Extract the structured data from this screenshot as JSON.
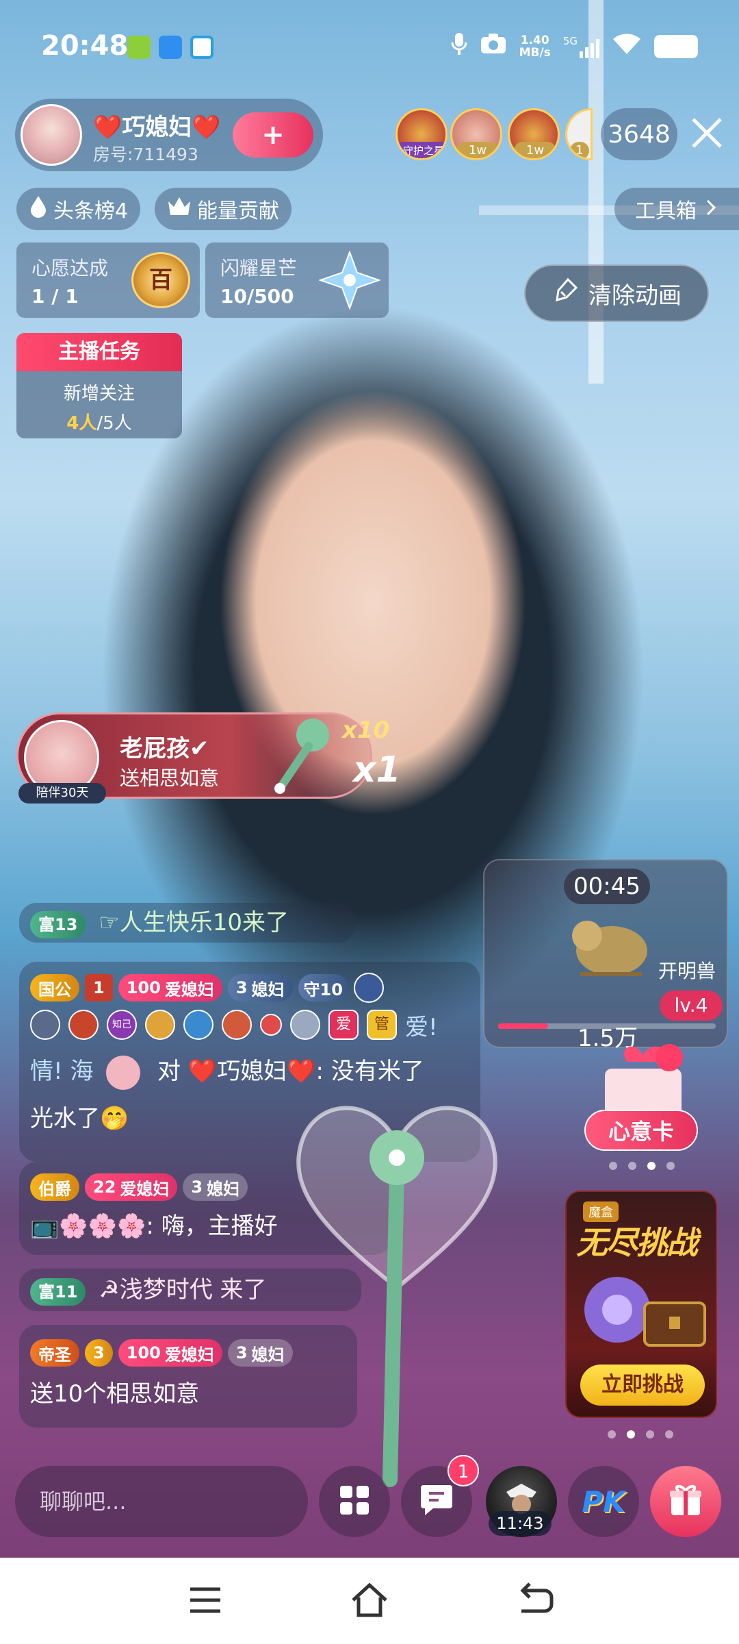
{
  "status_bar": {
    "time": "20:48",
    "net_speed_value": "1.40",
    "net_speed_unit": "MB/s",
    "network": "5G"
  },
  "host": {
    "name": "❤️巧媳妇❤️",
    "room": "房号:711493",
    "follow_label": "+"
  },
  "viewers": {
    "badge1": "守护之星",
    "badge2": "1w",
    "badge3": "1w",
    "badge4": "1",
    "count": "3648"
  },
  "chips": {
    "headline": "头条榜4",
    "energy": "能量贡献",
    "toolbox": "工具箱"
  },
  "wish": {
    "title": "心愿达成",
    "value": "1 / 1",
    "medal": "百"
  },
  "star": {
    "title": "闪耀星芒",
    "value": "10/500"
  },
  "clear_anim": "清除动画",
  "task": {
    "title": "主播任务",
    "label": "新增关注",
    "done": "4人",
    "total": "/5人"
  },
  "gift_banner": {
    "sender": "老屁孩✔",
    "message": "送相思如意",
    "accompany": "陪伴30天",
    "combo10": "x10",
    "combo1": "x1"
  },
  "chat": [
    {
      "badge_fu": "富13",
      "text": "☞人生快乐10来了"
    },
    {
      "rank": "国公",
      "lv": "1",
      "fan_lv": "100",
      "fan_name": "爱媳妇",
      "fan2_lv": "3",
      "fan2_name": "媳妇",
      "guard": "守10",
      "line2_tail": "爱!",
      "line3_prefix": "情!",
      "line3_mid": "海",
      "line3_text": "对 ❤️巧媳妇❤️: 没有米了",
      "line4": "光水了🤭",
      "small_badges": [
        "知己",
        "爱",
        "管"
      ]
    },
    {
      "rank": "伯爵",
      "fan_lv": "22",
      "fan_name": "爱媳妇",
      "fan2_lv": "3",
      "fan2_name": "媳妇",
      "text": "📺🌸🌸🌸: 嗨，主播好"
    },
    {
      "badge_fu": "富11",
      "text": "☭浅梦时代 来了"
    },
    {
      "rank": "帝圣",
      "lv": "3",
      "fan_lv": "100",
      "fan_name": "爱媳妇",
      "fan2_lv": "3",
      "fan2_name": "媳妇",
      "text": "送10个相思如意"
    }
  ],
  "beast": {
    "timer": "00:45",
    "name": "开明兽",
    "level": "lv.4",
    "amount": "1.5万",
    "progress": 0.23
  },
  "wish_card": {
    "label": "心意卡"
  },
  "challenge": {
    "sub": "魔盒",
    "title": "无尽挑战",
    "button": "立即挑战"
  },
  "bottom": {
    "input_placeholder": "聊聊吧...",
    "chat_notif": "1",
    "timer": "11:43",
    "pk": "PK"
  },
  "colors": {
    "accent_pink": "#e7325e",
    "gold": "#ffd24a"
  }
}
